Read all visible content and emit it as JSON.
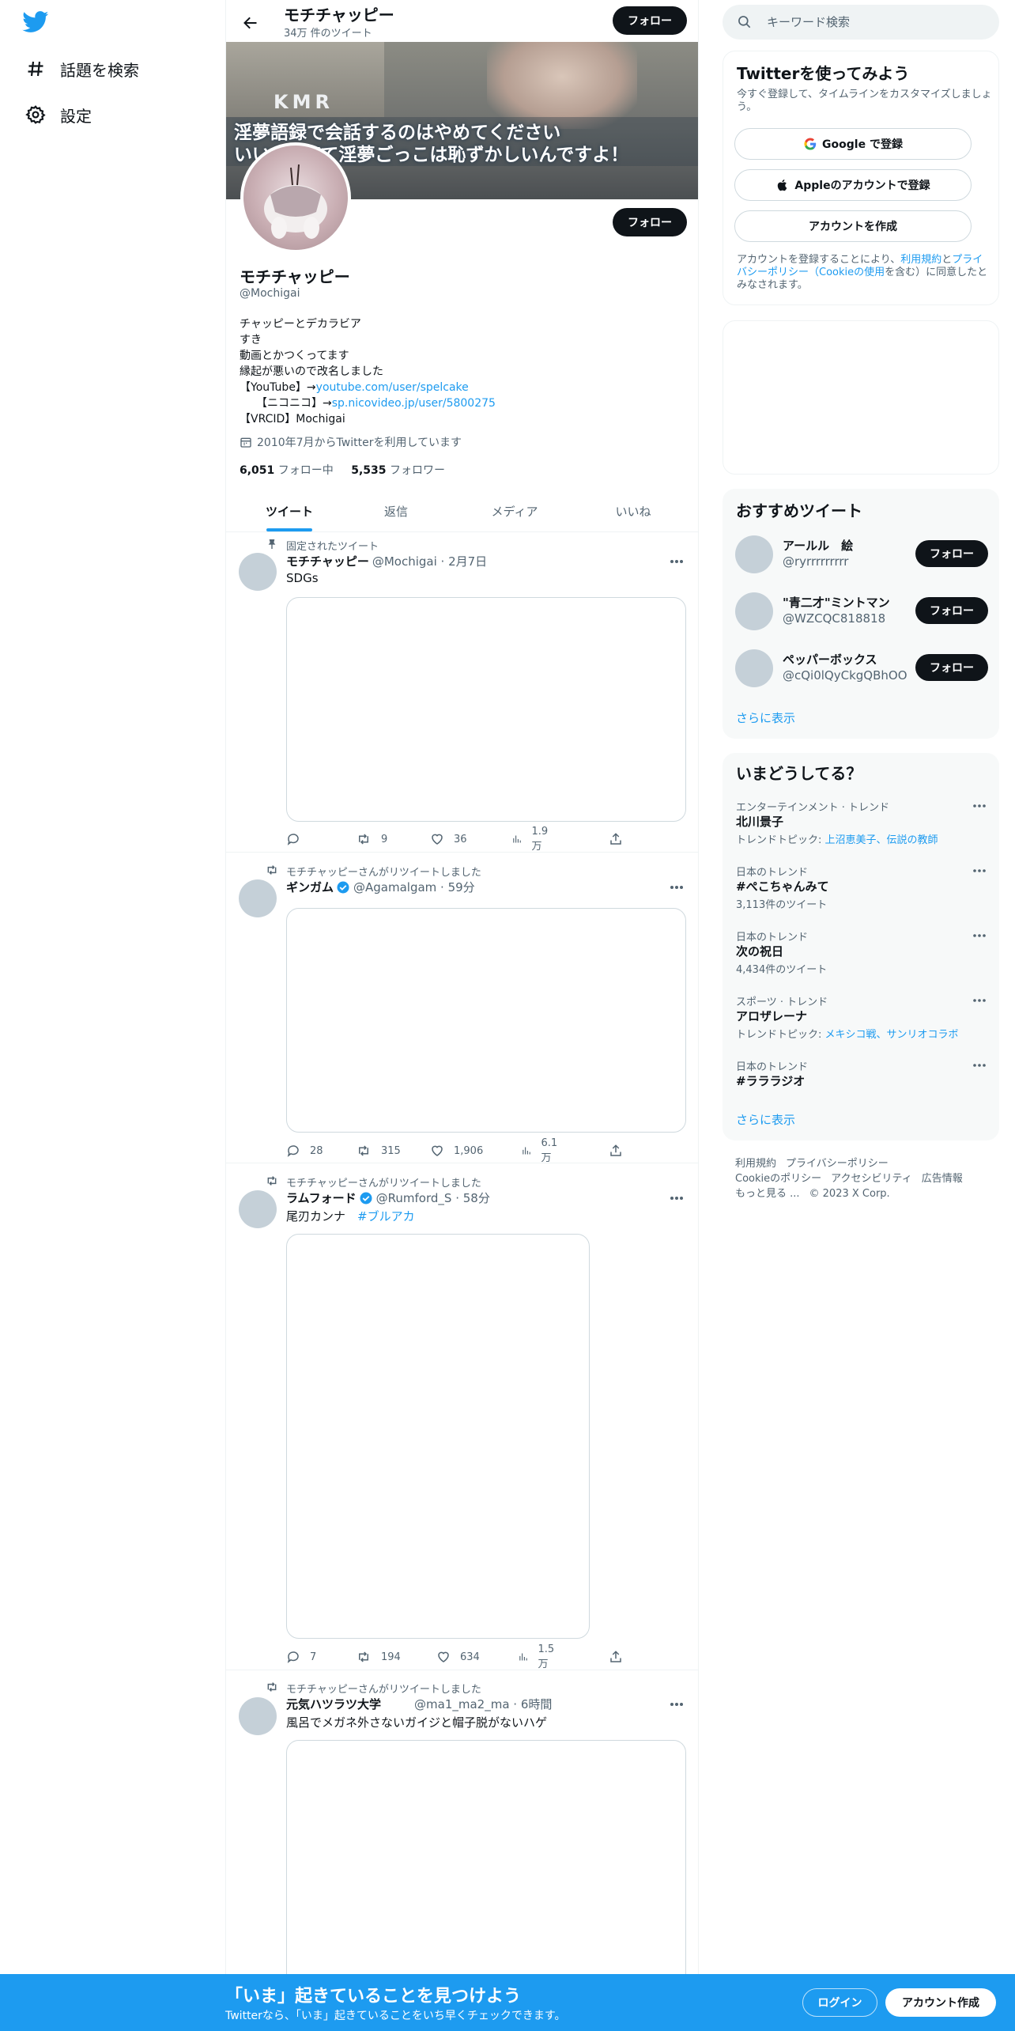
{
  "nav": {
    "logo_icon": "twitter-bird-icon",
    "items": [
      {
        "label": "話題を検索",
        "icon": "hashtag-icon"
      },
      {
        "label": "設定",
        "icon": "gear-icon"
      }
    ]
  },
  "header": {
    "name": "モチチャッピー",
    "tweet_count": "34万 件のツイート",
    "follow_label": "フォロー"
  },
  "banner": {
    "line_kmr": "KMR",
    "line1": "淫夢語録で会話するのはやめてください",
    "line2": "いいか、Kて淫夢ごっこは恥ずかしいんですよ！"
  },
  "profile": {
    "follow_label": "フォロー",
    "name": "モチチャッピー",
    "handle": "@Mochigai",
    "bio": [
      "チャッピーとデカラビア",
      "すき",
      "動画とかつくってます",
      "縁起が悪いので改名しました"
    ],
    "youtube_prefix": "【YouTube】→",
    "youtube_link": "youtube.com/user/spelcake",
    "nico_prefix": "　　【ニコニコ】→",
    "nico_link": "sp.nicovideo.jp/user/5800275",
    "vrcid": "【VRCID】Mochigai",
    "joined": "2010年7月からTwitterを利用しています",
    "following_count": "6,051",
    "following_label": "フォロー中",
    "followers_count": "5,535",
    "followers_label": "フォロワー"
  },
  "tabs": [
    "ツイート",
    "返信",
    "メディア",
    "いいね"
  ],
  "tweets": [
    {
      "context": "固定されたツイート",
      "name": "モチチャッピー",
      "meta": "@Mochigai · 2月7日",
      "text": "SDGs",
      "reply": "",
      "retweet": "9",
      "like": "36",
      "views": "1.9万"
    },
    {
      "context": "モチチャッピーさんがリツイートしました",
      "name": "ギンガム",
      "meta": "@Agamalgam · 59分",
      "text": "",
      "reply": "28",
      "retweet": "315",
      "like": "1,906",
      "views": "6.1万"
    },
    {
      "context": "モチチャッピーさんがリツイートしました",
      "name": "ラムフォード",
      "meta": "@Rumford_S · 58分",
      "text": "尾刃カンナ",
      "hashtag": "#ブルアカ",
      "reply": "7",
      "retweet": "194",
      "like": "634",
      "views": "1.5万"
    },
    {
      "context": "モチチャッピーさんがリツイートしました",
      "name": "元気ハツラツ大学",
      "meta": "@ma1_ma2_ma · 6時間",
      "text": "風呂でメガネ外さないガイジと帽子脱がないハゲ"
    }
  ],
  "search": {
    "placeholder": "キーワード検索"
  },
  "signup_card": {
    "title": "Twitterを使ってみよう",
    "subtitle_l1": "今すぐ登録して、タイムラインをカスタマイズしましょ",
    "subtitle_l2": "う。",
    "google_label": "Google で登録",
    "apple_label": "Appleのアカウントで登録",
    "create_label": "アカウントを作成",
    "terms_l1_a": "アカウントを登録することにより、",
    "terms_l1_link1": "利用規約",
    "terms_l1_b": "と",
    "terms_l1_link2": "プライ",
    "terms_l2_link": "バシーポリシー（Cookieの使用",
    "terms_l2_b": "を含む）に同意したと",
    "terms_l3": "みなされます。"
  },
  "recommend": {
    "title": "おすすめツイート",
    "follow_label": "フォロー",
    "users": [
      {
        "name": "アールル　絵",
        "handle": "@ryrrrrrrrrr"
      },
      {
        "name": "\"青二才\"ミントマン",
        "handle": "@WZCQC818818"
      },
      {
        "name": "ペッパーボックス",
        "handle": "@cQi0lQyCkgQBhOO"
      }
    ],
    "show_more": "さらに表示"
  },
  "trends": {
    "title": "いまどうしてる？",
    "items": [
      {
        "category": "エンターテインメント · トレンド",
        "name": "北川景子",
        "sub_prefix": "トレンドトピック: ",
        "sub_links": "上沼恵美子、伝説の教師"
      },
      {
        "category": "日本のトレンド",
        "name": "#ぺこちゃんみて",
        "sub_prefix": "3,113件のツイート",
        "sub_links": ""
      },
      {
        "category": "日本のトレンド",
        "name": "次の祝日",
        "sub_prefix": "4,434件のツイート",
        "sub_links": ""
      },
      {
        "category": "スポーツ · トレンド",
        "name": "アロザレーナ",
        "sub_prefix": "トレンドトピック: ",
        "sub_links": "メキシコ戦、サンリオコラボ"
      },
      {
        "category": "日本のトレンド",
        "name": "#ラララジオ",
        "sub_prefix": "",
        "sub_links": ""
      }
    ],
    "show_more": "さらに表示"
  },
  "footer": {
    "line1": [
      "利用規約",
      "プライバシーポリシー"
    ],
    "line2": [
      "Cookieのポリシー",
      "アクセシビリティ",
      "広告情報"
    ],
    "line3": [
      "もっと見る ...",
      "© 2023 X Corp."
    ]
  },
  "bottom_bar": {
    "title": "「いま」起きていることを見つけよう",
    "subtitle": "Twitterなら、「いま」起きていることをいち早くチェックできます。",
    "login": "ログイン",
    "signup": "アカウント作成"
  },
  "colors": {
    "accent": "#1d9bf0",
    "dark": "#0f1419",
    "muted": "#536471"
  }
}
